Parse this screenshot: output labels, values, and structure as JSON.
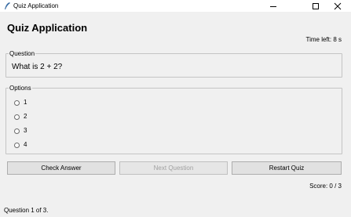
{
  "window": {
    "title": "Quiz Application",
    "icon": "feather-icon"
  },
  "header": {
    "title": "Quiz Application",
    "timer": "Time left: 8 s"
  },
  "question_group": {
    "legend": "Question",
    "text": "What is 2 + 2?"
  },
  "options_group": {
    "legend": "Options",
    "options": [
      {
        "label": "1",
        "selected": false
      },
      {
        "label": "2",
        "selected": false
      },
      {
        "label": "3",
        "selected": false
      },
      {
        "label": "4",
        "selected": false
      }
    ]
  },
  "buttons": {
    "check": "Check Answer",
    "next": "Next Question",
    "next_disabled": true,
    "restart": "Restart Quiz"
  },
  "score": "Score: 0 / 3",
  "progress": "Question 1 of 3."
}
